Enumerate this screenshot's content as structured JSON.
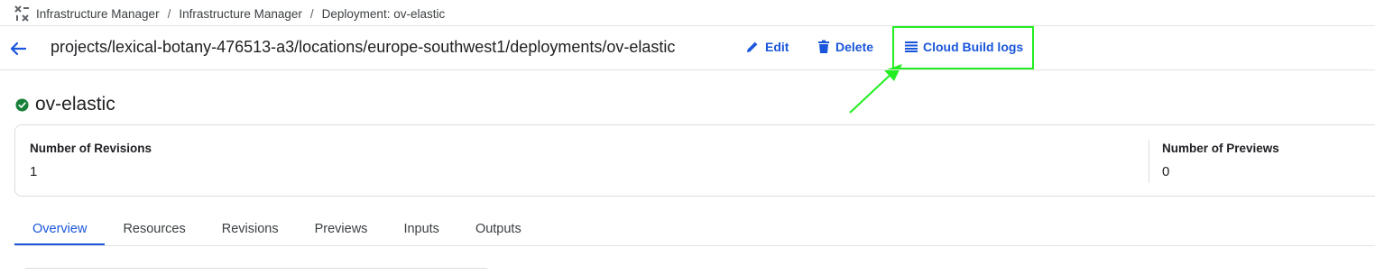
{
  "breadcrumb": {
    "items": [
      "Infrastructure Manager",
      "Infrastructure Manager",
      "Deployment: ov-elastic"
    ],
    "separator": "/"
  },
  "header": {
    "path": "projects/lexical-botany-476513-a3/locations/europe-southwest1/deployments/ov-elastic",
    "actions": {
      "edit_label": "Edit",
      "delete_label": "Delete",
      "logs_label": "Cloud Build logs"
    }
  },
  "resource": {
    "name": "ov-elastic",
    "status_icon": "check-circle-icon"
  },
  "stats": {
    "revisions_label": "Number of Revisions",
    "revisions_value": "1",
    "previews_label": "Number of Previews",
    "previews_value": "0"
  },
  "tabs": [
    "Overview",
    "Resources",
    "Revisions",
    "Previews",
    "Inputs",
    "Outputs"
  ],
  "active_tab": "Overview",
  "colors": {
    "accent": "#1a56db",
    "success": "#188038",
    "highlight": "#22ee22"
  }
}
